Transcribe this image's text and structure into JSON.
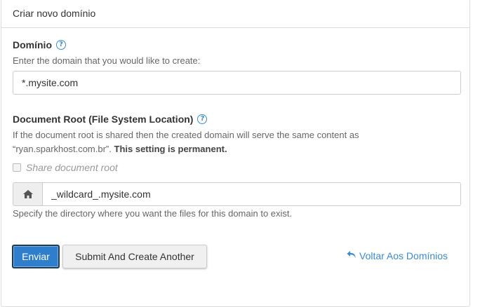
{
  "panel": {
    "heading": "Criar novo domínio"
  },
  "domain": {
    "label": "Domínio",
    "help_icon": "question-circle-icon",
    "description": "Enter the domain that you would like to create:",
    "value": "*.mysite.com"
  },
  "docroot": {
    "label": "Document Root (File System Location)",
    "help_icon": "question-circle-icon",
    "description_line1": "If the document root is shared then the created domain will serve the same content as",
    "description_line2_prefix": "“ryan.sparkhost.com.br”.",
    "description_line2_bold": "This setting is permanent.",
    "share_checkbox_label": "Share document root",
    "share_checked": false,
    "addon_icon": "home-icon",
    "value": "_wildcard_.mysite.com",
    "hint": "Specify the directory where you want the files for this domain to exist."
  },
  "actions": {
    "submit_label": "Enviar",
    "submit_another_label": "Submit And Create Another",
    "back_label": "Voltar Aos Domínios",
    "back_icon": "undo-arrow-icon"
  },
  "colors": {
    "primary": "#2f7ecb",
    "link": "#3b8bd1"
  }
}
